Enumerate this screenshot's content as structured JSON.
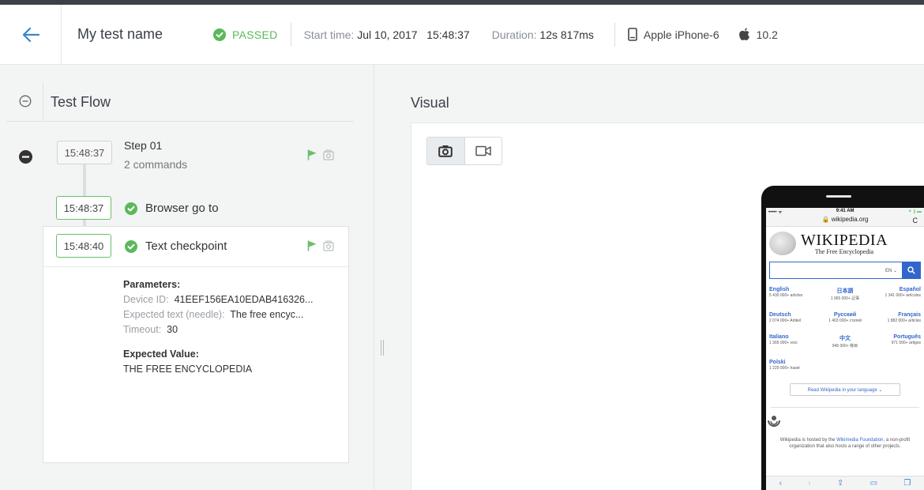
{
  "header": {
    "test_name": "My test name",
    "status": "PASSED",
    "start_label": "Start time:",
    "start_value": "Jul 10, 2017   15:48:37",
    "duration_label": "Duration:",
    "duration_value": "12s 817ms",
    "device": "Apple iPhone-6",
    "os_version": "10.2"
  },
  "colors": {
    "accent": "#3a87c8",
    "success": "#5cb85c",
    "step_green": "#6bbf6b"
  },
  "test_flow": {
    "title": "Test Flow",
    "step": {
      "time": "15:48:37",
      "title": "Step 01",
      "subtitle": "2 commands"
    },
    "commands": [
      {
        "time": "15:48:37",
        "label": "Browser go to"
      },
      {
        "time": "15:48:40",
        "label": "Text checkpoint"
      }
    ],
    "details": {
      "params_label": "Parameters:",
      "device_id_key": "Device ID:",
      "device_id_value": "41EEF156EA10EDAB416326...",
      "expected_text_key": "Expected text (needle):",
      "expected_text_value": "The free encyc...",
      "timeout_key": "Timeout:",
      "timeout_value": "30",
      "expected_value_label": "Expected Value:",
      "expected_value": "THE FREE ENCYCLOPEDIA"
    }
  },
  "visual": {
    "title": "Visual",
    "modes": [
      "screenshot",
      "video"
    ],
    "active_mode": "screenshot"
  },
  "phone_screen": {
    "carrier": "••••• ᯤ",
    "time": "9:41 AM",
    "battery": "✦ ∦ ▬",
    "url": "🔒 wikipedia.org",
    "reload": "C",
    "wordmark": "WIKIPEDIA",
    "tagline": "The Free Encyclopedia",
    "search_lang": "EN ⌄",
    "languages": [
      {
        "name": "English",
        "count": "5 430 000+ articles"
      },
      {
        "name": "日本語",
        "count": "1 065 000+ 記事"
      },
      {
        "name": "Español",
        "count": "1 341 000+ artículos"
      },
      {
        "name": "Deutsch",
        "count": "2 074 000+ Artikel"
      },
      {
        "name": "Русский",
        "count": "1 403 000+ статей"
      },
      {
        "name": "Français",
        "count": "1 882 000+ articles"
      },
      {
        "name": "Italiano",
        "count": "1 365 000+ voci"
      },
      {
        "name": "中文",
        "count": "945 000+ 條目"
      },
      {
        "name": "Português",
        "count": "971 000+ artigos"
      },
      {
        "name": "Polski",
        "count": "1 229 000+ haseł"
      }
    ],
    "read_button": "Read Wikipedia in your language  ⌄",
    "footer_1": "Wikipedia is hosted by the",
    "footer_link": "Wikimedia Foundation,",
    "footer_2": "a non-profit organization that also hosts a range of other projects."
  }
}
